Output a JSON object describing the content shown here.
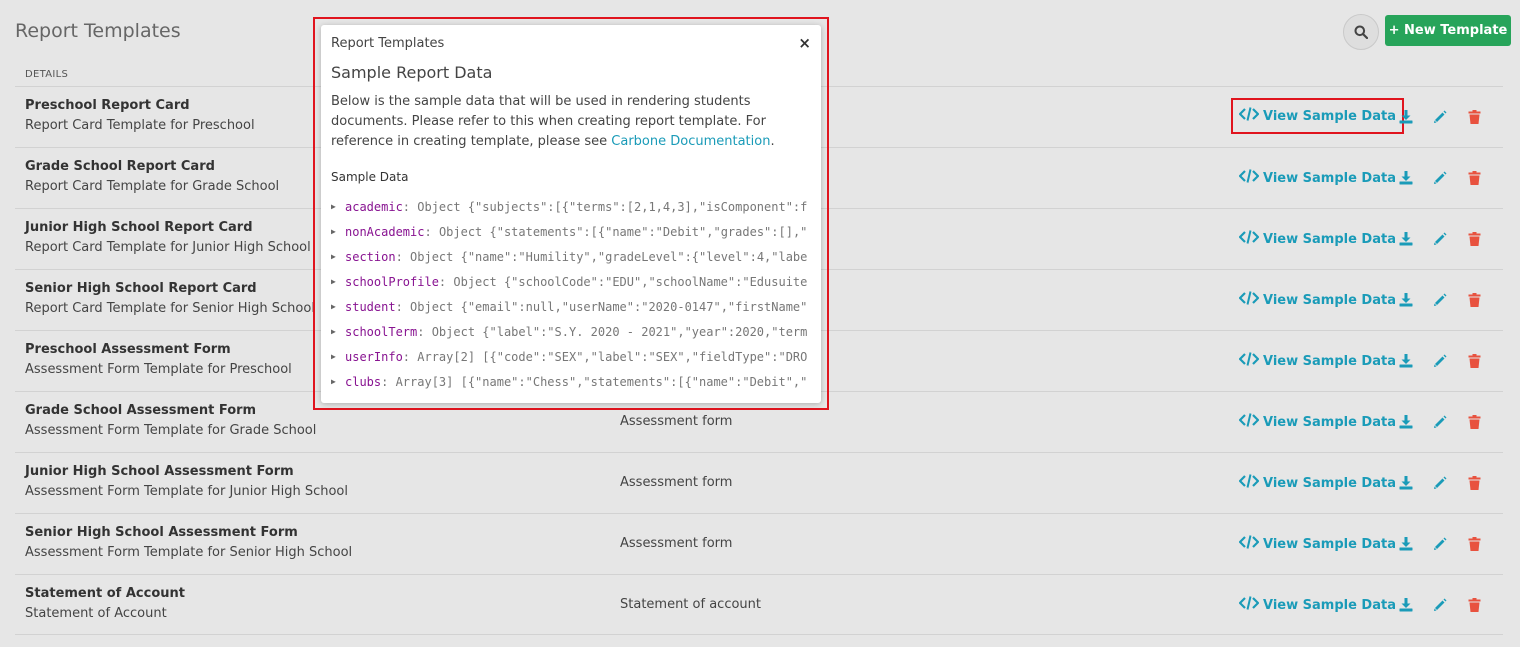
{
  "header": {
    "title": "Report Templates",
    "new_button": "+ New Template",
    "column_header": "DETAILS"
  },
  "rows": [
    {
      "title": "Preschool Report Card",
      "subtitle": "Report Card Template for Preschool",
      "type": ""
    },
    {
      "title": "Grade School Report Card",
      "subtitle": "Report Card Template for Grade School",
      "type": ""
    },
    {
      "title": "Junior High School Report Card",
      "subtitle": "Report Card Template for Junior High School",
      "type": ""
    },
    {
      "title": "Senior High School Report Card",
      "subtitle": "Report Card Template for Senior High School",
      "type": ""
    },
    {
      "title": "Preschool Assessment Form",
      "subtitle": "Assessment Form Template for Preschool",
      "type": ""
    },
    {
      "title": "Grade School Assessment Form",
      "subtitle": "Assessment Form Template for Grade School",
      "type": "Assessment form"
    },
    {
      "title": "Junior High School Assessment Form",
      "subtitle": "Assessment Form Template for Junior High School",
      "type": "Assessment form"
    },
    {
      "title": "Senior High School Assessment Form",
      "subtitle": "Assessment Form Template for Senior High School",
      "type": "Assessment form"
    },
    {
      "title": "Statement of Account",
      "subtitle": "Statement of Account",
      "type": "Statement of account"
    }
  ],
  "row_actions": {
    "view_label": "View Sample Data",
    "icons": [
      "code-icon",
      "download-icon",
      "pencil-icon",
      "trash-icon"
    ]
  },
  "modal": {
    "breadcrumb": "Report Templates",
    "close": "×",
    "title": "Sample Report Data",
    "desc_text": "Below is the sample data that will be used in rendering students documents. Please refer to this when creating report template. For reference in creating template, please see ",
    "desc_link": "Carbone Documentation",
    "desc_end": ".",
    "sample_label": "Sample Data",
    "tree": [
      {
        "key": "academic",
        "value": "Object {\"subjects\":[{\"terms\":[2,1,4,3],\"isComponent\":f"
      },
      {
        "key": "nonAcademic",
        "value": "Object {\"statements\":[{\"name\":\"Debit\",\"grades\":[],\""
      },
      {
        "key": "section",
        "value": "Object {\"name\":\"Humility\",\"gradeLevel\":{\"level\":4,\"labe"
      },
      {
        "key": "schoolProfile",
        "value": "Object {\"schoolCode\":\"EDU\",\"schoolName\":\"Edusuite"
      },
      {
        "key": "student",
        "value": "Object {\"email\":null,\"userName\":\"2020-0147\",\"firstName\""
      },
      {
        "key": "schoolTerm",
        "value": "Object {\"label\":\"S.Y. 2020 - 2021\",\"year\":2020,\"term"
      },
      {
        "key": "userInfo",
        "value": "Array[2] [{\"code\":\"SEX\",\"label\":\"SEX\",\"fieldType\":\"DRO"
      },
      {
        "key": "clubs",
        "value": "Array[3] [{\"name\":\"Chess\",\"statements\":[{\"name\":\"Debit\",\""
      }
    ]
  },
  "colors": {
    "accent": "#1a9bb8",
    "primary_button": "#27a45a",
    "delete": "#e8523f",
    "highlight": "#e0141e",
    "json_key": "#881391"
  }
}
